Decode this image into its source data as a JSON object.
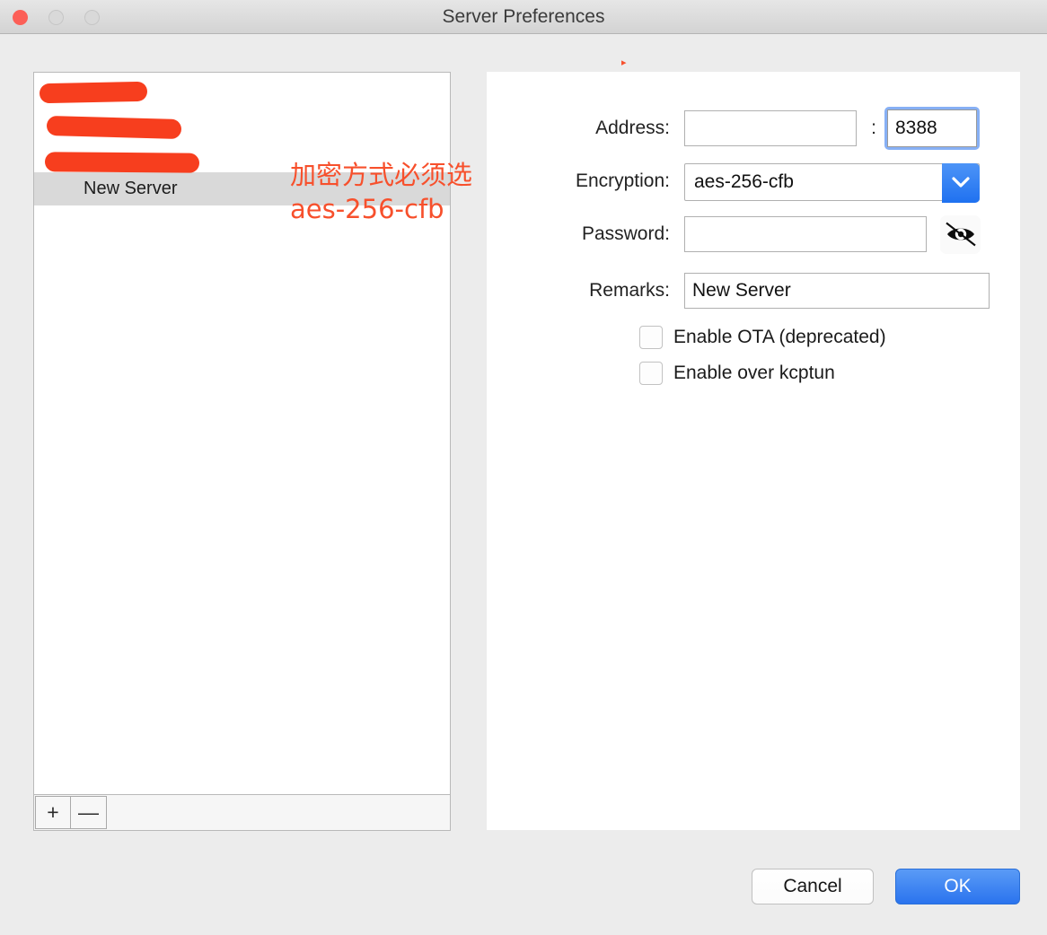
{
  "window": {
    "title": "Server Preferences",
    "traffic_lights": {
      "close": "close-button",
      "minimize": "minimize-button",
      "maximize": "maximize-button"
    }
  },
  "server_list": {
    "items": [
      {
        "label": "",
        "redacted": true,
        "selected": false
      },
      {
        "label": "",
        "redacted": true,
        "selected": false
      },
      {
        "label": "",
        "redacted": true,
        "selected": false
      },
      {
        "label": "New Server",
        "redacted": false,
        "selected": true
      }
    ],
    "add_label": "+",
    "remove_label": "—"
  },
  "form": {
    "address": {
      "label": "Address:",
      "value": "",
      "placeholder": ""
    },
    "port_separator": ":",
    "port": {
      "value": "8388",
      "focused": true
    },
    "encryption": {
      "label": "Encryption:",
      "value": "aes-256-cfb",
      "chevron": "chevron-down-icon"
    },
    "password": {
      "label": "Password:",
      "value": "",
      "placeholder": "",
      "toggle_icon": "eye-off-icon"
    },
    "remarks": {
      "label": "Remarks:",
      "value": "New Server"
    },
    "checkboxes": [
      {
        "label": "Enable OTA (deprecated)",
        "checked": false
      },
      {
        "label": "Enable over kcptun",
        "checked": false
      }
    ]
  },
  "footer": {
    "cancel_label": "Cancel",
    "ok_label": "OK"
  },
  "annotations": {
    "note": "加密方式必须选\naes-256-cfb",
    "speck": "▸",
    "color": "#f7502c",
    "redaction_color": "#f73e1e"
  },
  "colors": {
    "accent_blue": "#2a73ee",
    "window_bg": "#ececec",
    "panel_bg": "#ffffff",
    "selection_gray": "#d9d9d9"
  }
}
